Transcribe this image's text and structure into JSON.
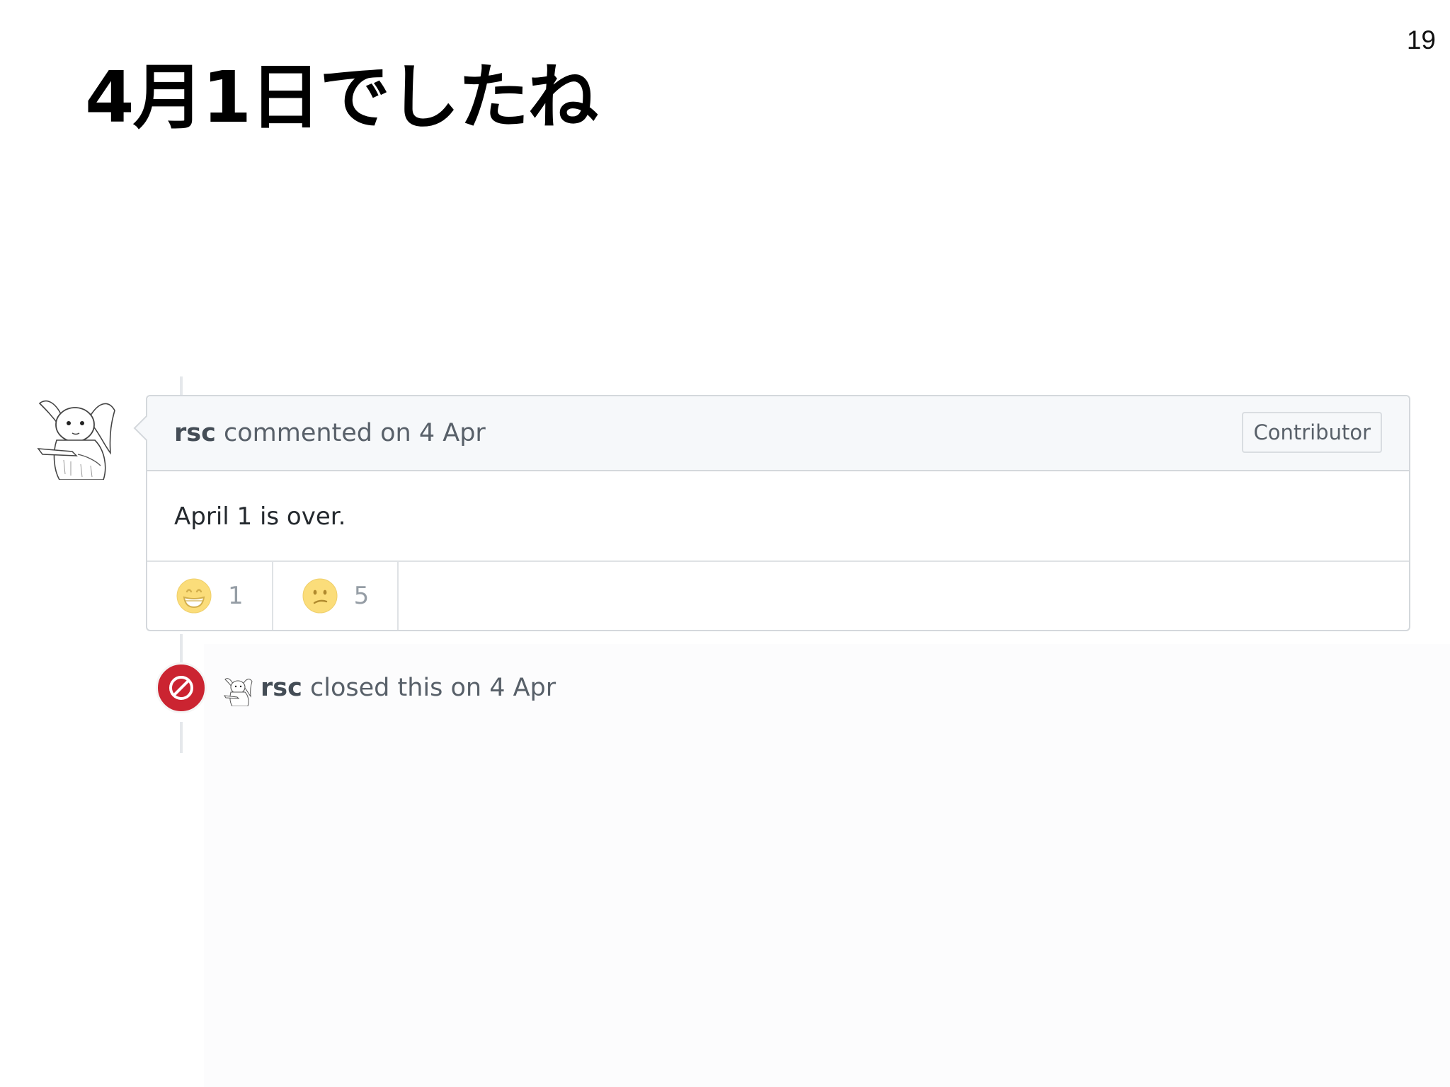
{
  "slide": {
    "page_number": "19",
    "title": "4月1日でしたね"
  },
  "comment": {
    "author": "rsc",
    "action": "commented on 4 Apr",
    "role_badge": "Contributor",
    "body": "April 1 is over.",
    "avatar_icon": "rabbit-avatar-icon",
    "reactions": [
      {
        "emoji_icon": "grinning-face-icon",
        "count": "1"
      },
      {
        "emoji_icon": "confused-face-icon",
        "count": "5"
      }
    ]
  },
  "event": {
    "icon": "circle-slash-icon",
    "author": "rsc",
    "action": "closed this on 4 Apr",
    "color": "#cb2431"
  }
}
